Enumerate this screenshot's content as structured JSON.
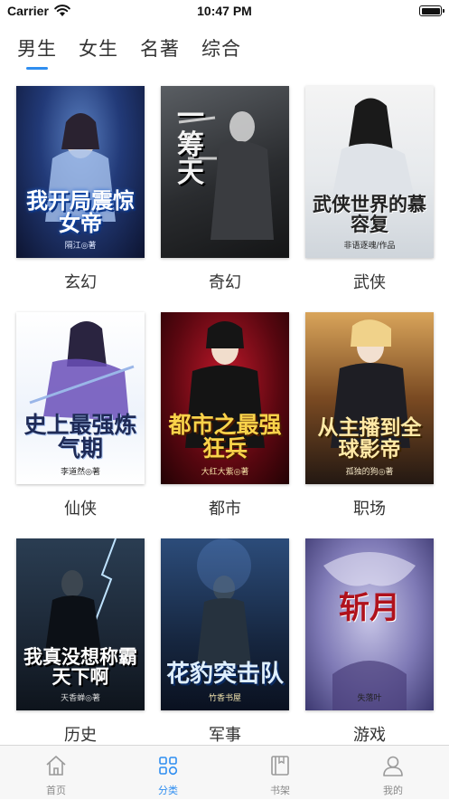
{
  "status_bar": {
    "carrier": "Carrier",
    "time": "10:47 PM"
  },
  "top_tabs": [
    {
      "label": "男生",
      "active": true
    },
    {
      "label": "女生",
      "active": false
    },
    {
      "label": "名著",
      "active": false
    },
    {
      "label": "综合",
      "active": false
    }
  ],
  "accent_color": "#2f8ef0",
  "categories": [
    {
      "label": "玄幻",
      "cover_title": "我开局震惊女帝",
      "cover_author": "隔江◎著"
    },
    {
      "label": "奇幻",
      "cover_title": "一筹天",
      "cover_author": ""
    },
    {
      "label": "武侠",
      "cover_title": "武侠世界的慕容复",
      "cover_author": "非语逐魂/作品"
    },
    {
      "label": "仙侠",
      "cover_title": "史上最强炼气期",
      "cover_author": "李道然◎著"
    },
    {
      "label": "都市",
      "cover_title": "都市之最强狂兵",
      "cover_author": "大红大紫◎著"
    },
    {
      "label": "职场",
      "cover_title": "从主播到全球影帝",
      "cover_author": "孤独的狗◎著"
    },
    {
      "label": "历史",
      "cover_title": "我真没想称霸天下啊",
      "cover_author": "天香蝉◎著"
    },
    {
      "label": "军事",
      "cover_title": "花豹突击队",
      "cover_author": "竹香书屋"
    },
    {
      "label": "游戏",
      "cover_title": "斩月",
      "cover_author": "失落叶"
    }
  ],
  "tabbar": [
    {
      "label": "首页",
      "icon": "home-icon",
      "active": false
    },
    {
      "label": "分类",
      "icon": "category-grid-icon",
      "active": true
    },
    {
      "label": "书架",
      "icon": "bookshelf-icon",
      "active": false
    },
    {
      "label": "我的",
      "icon": "profile-icon",
      "active": false
    }
  ]
}
